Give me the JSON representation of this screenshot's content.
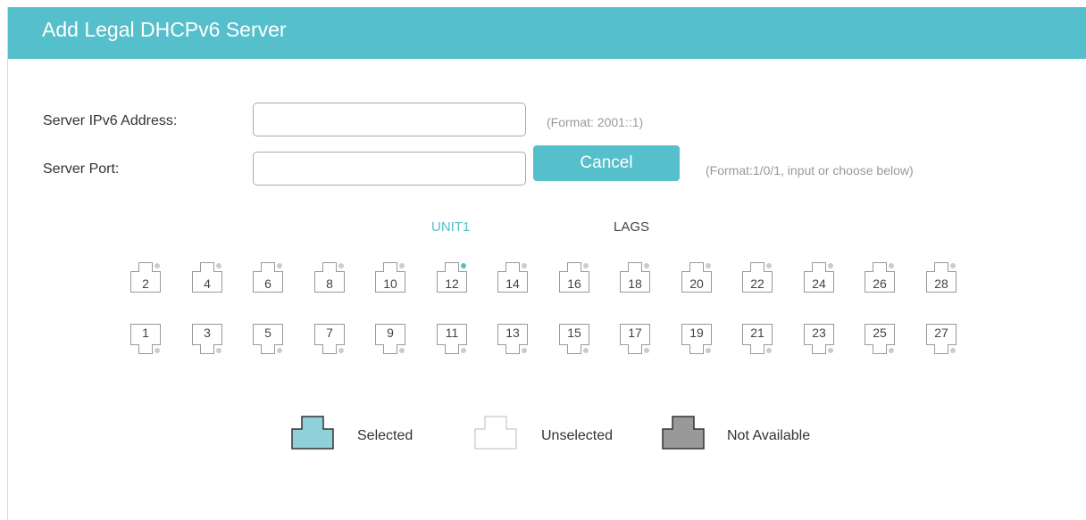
{
  "dialog": {
    "title": "Add Legal DHCPv6 Server"
  },
  "form": {
    "ipv6_label": "Server IPv6 Address:",
    "ipv6_value": "",
    "ipv6_hint": "(Format: 2001::1)",
    "port_label": "Server Port:",
    "port_value": "",
    "cancel_label": "Cancel",
    "port_hint": "(Format:1/0/1, input or choose below)"
  },
  "tabs": {
    "unit": "UNIT1",
    "lags": "LAGS"
  },
  "ports": {
    "top_row": [
      "2",
      "4",
      "6",
      "8",
      "10",
      "12",
      "14",
      "16",
      "18",
      "20",
      "22",
      "24",
      "26",
      "28"
    ],
    "bottom_row": [
      "1",
      "3",
      "5",
      "7",
      "9",
      "11",
      "13",
      "15",
      "17",
      "19",
      "21",
      "23",
      "25",
      "27"
    ],
    "active_indicator_port": "12"
  },
  "legend": {
    "selected": "Selected",
    "unselected": "Unselected",
    "not_available": "Not Available"
  },
  "colors": {
    "accent": "#55bfcb",
    "selected_fill": "#8fd0d9",
    "not_available_fill": "#999999",
    "port_border": "#999999",
    "indicator_off": "#cccccc"
  }
}
